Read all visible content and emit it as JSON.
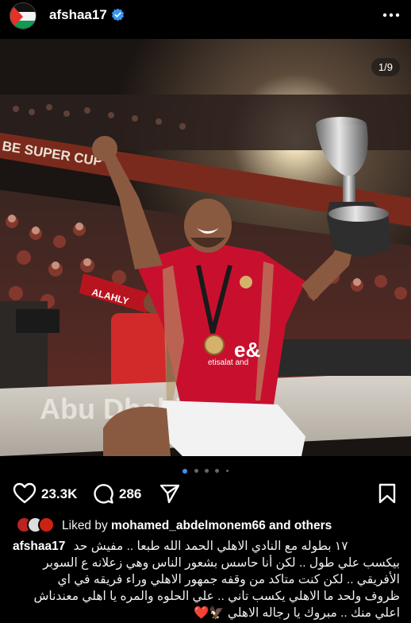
{
  "header": {
    "username": "afshaa17",
    "avatar_icon": "palestine-flag-avatar",
    "verified_icon": "verified-badge-icon",
    "more_icon": "more-options-icon"
  },
  "post": {
    "counter": "1/9",
    "photo_texts": {
      "banner": "BE SUPER CUP",
      "jersey_sponsor": "etisalat and",
      "board": "Abu Dhabi",
      "flag": "ALAHLY"
    },
    "carousel": {
      "total_visible_dots": 5,
      "active_index": 0
    }
  },
  "actions": {
    "likes": "23.3K",
    "comments": "286",
    "like_icon": "heart-icon",
    "comment_icon": "comment-icon",
    "share_icon": "share-icon",
    "save_icon": "bookmark-icon"
  },
  "liked_by": {
    "prefix": "Liked by",
    "user": "mohamed_abdelmonem66",
    "suffix": "and others"
  },
  "caption": {
    "username": "afshaa17",
    "line1": "١٧ بطوله مع النادي الاهلي الحمد الله طبعا .. مفيش حد",
    "line2": "بيكسب علي طول .. لكن أنا حاسس بشعور  الناس وهي زعلانه ع السوبر",
    "line3": "الأفريقي .. لكن كنت متاكد من وقفه جمهور الاهلي وراء  فريقه في اي",
    "line4": "ظروف ولحد ما الاهلي يكسب تاني .. علي الحلوه والمره يا اهلي معندناش",
    "line5": "اعلي منك .. مبروك يا رجاله الاهلي 🦅❤️"
  },
  "colors": {
    "background": "#000000",
    "accent": "#3897f0",
    "jersey_red": "#c8102e"
  }
}
